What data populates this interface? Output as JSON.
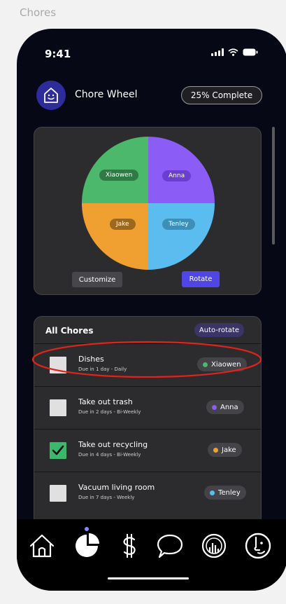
{
  "frame_label": "Chores",
  "status_bar": {
    "time": "9:41"
  },
  "header": {
    "app_title": "Chore Wheel",
    "progress_badge": "25% Complete"
  },
  "wheel": {
    "slices": [
      {
        "name": "Xiaowen",
        "color": "#4cb86b",
        "label_bg": "#2f7a45"
      },
      {
        "name": "Anna",
        "color": "#8b5cf6",
        "label_bg": "#6a3fd0"
      },
      {
        "name": "Jake",
        "color": "#f0a030",
        "label_bg": "#9c6820"
      },
      {
        "name": "Tenley",
        "color": "#5bbcef",
        "label_bg": "#3d8fb8"
      }
    ],
    "customize_label": "Customize",
    "rotate_label": "Rotate"
  },
  "chores": {
    "title": "All Chores",
    "auto_rotate_label": "Auto-rotate",
    "items": [
      {
        "name": "Dishes",
        "due": "Due in 1 day - Daily",
        "checked": false,
        "assignee": "Xiaowen",
        "dot_color": "#4cb86b"
      },
      {
        "name": "Take out trash",
        "due": "Due in 2 days - Bi-Weekly",
        "checked": false,
        "assignee": "Anna",
        "dot_color": "#8b5cf6"
      },
      {
        "name": "Take out recycling",
        "due": "Due in 4 days - Bi-Weekly",
        "checked": true,
        "assignee": "Jake",
        "dot_color": "#f0a030"
      },
      {
        "name": "Vacuum living room",
        "due": "Due in 7 days - Weekly",
        "checked": false,
        "assignee": "Tenley",
        "dot_color": "#5bbcef"
      }
    ]
  },
  "bottom_nav": {
    "items": [
      "home-icon",
      "pie-chart-icon",
      "dollar-icon",
      "chat-bubble-icon",
      "stats-icon",
      "profile-face-icon"
    ],
    "active_index": 1,
    "accent": "#8a86ff"
  },
  "annotation": {
    "color": "#e0231b"
  }
}
